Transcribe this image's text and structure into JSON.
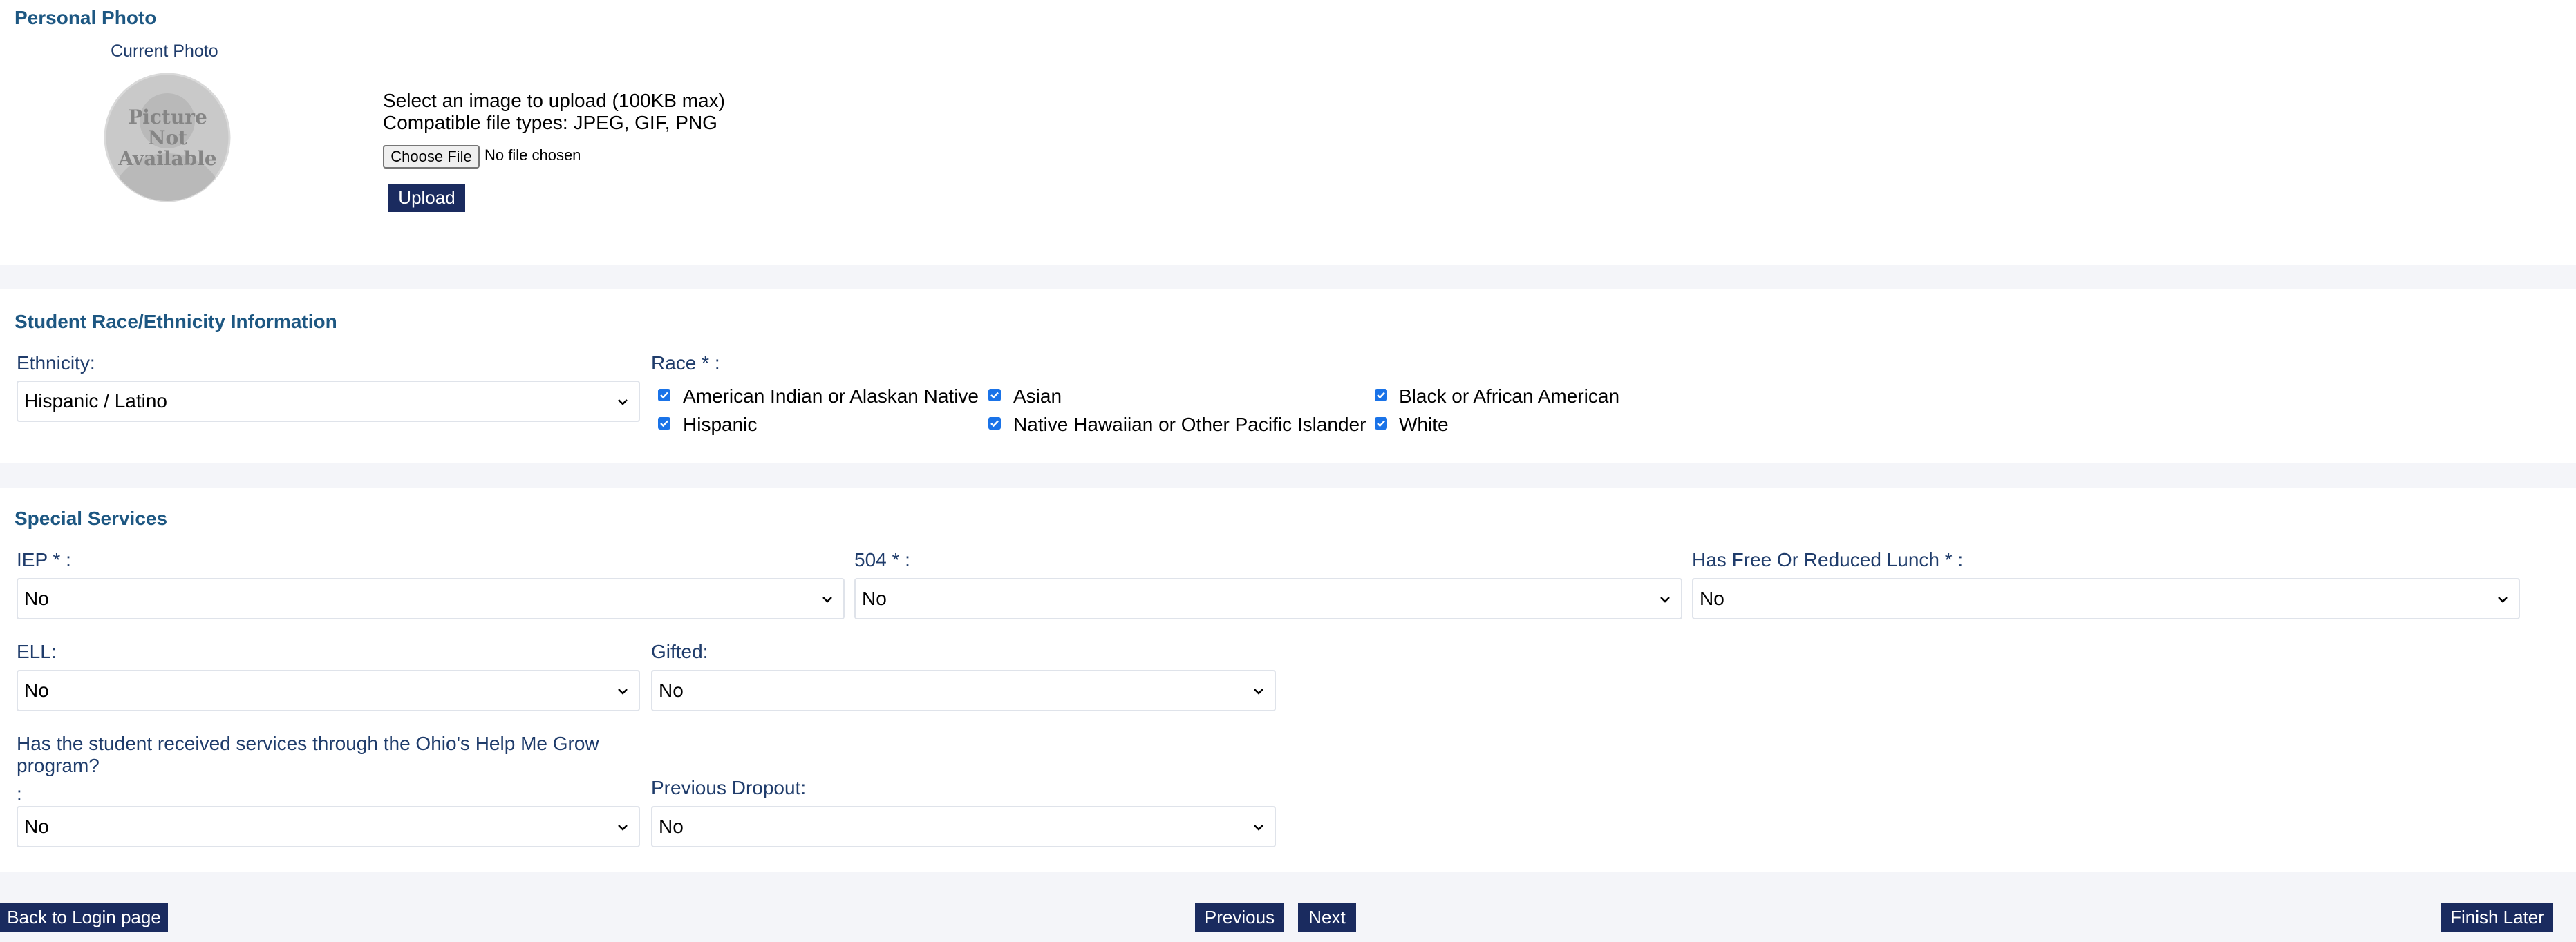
{
  "photo": {
    "section_title": "Personal Photo",
    "current_photo_label": "Current Photo",
    "placeholder_lines": [
      "Picture",
      "Not",
      "Available"
    ],
    "upload_instructions": "Select an image to upload (100KB max)",
    "file_types": "Compatible file types: JPEG, GIF, PNG",
    "choose_file_label": "Choose File",
    "no_file_text": "No file chosen",
    "upload_label": "Upload"
  },
  "race": {
    "section_title": "Student Race/Ethnicity Information",
    "ethnicity_label": "Ethnicity:",
    "ethnicity_value": "Hispanic / Latino",
    "race_label": "Race * :",
    "options": [
      {
        "label": "American Indian or Alaskan Native",
        "checked": true
      },
      {
        "label": "Asian",
        "checked": true
      },
      {
        "label": "Black or African American",
        "checked": true
      },
      {
        "label": "Hispanic",
        "checked": true
      },
      {
        "label": "Native Hawaiian or Other Pacific Islander",
        "checked": true
      },
      {
        "label": "White",
        "checked": true
      }
    ]
  },
  "services": {
    "section_title": "Special Services",
    "iep": {
      "label": "IEP * :",
      "value": "No"
    },
    "s504": {
      "label": "504 * :",
      "value": "No"
    },
    "lunch": {
      "label": "Has Free Or Reduced Lunch * :",
      "value": "No"
    },
    "ell": {
      "label": "ELL:",
      "value": "No"
    },
    "gifted": {
      "label": "Gifted:",
      "value": "No"
    },
    "help_me_grow": {
      "label": "Has the student received services through the Ohio's Help Me Grow program?",
      "colon": ":",
      "value": "No"
    },
    "dropout": {
      "label": "Previous Dropout:",
      "value": "No"
    }
  },
  "footer": {
    "back_label": "Back to Login page",
    "previous_label": "Previous",
    "next_label": "Next",
    "finish_label": "Finish Later"
  },
  "colors": {
    "navy": "#1a2b5f",
    "section_title": "#1d5782",
    "label": "#1f3c6b",
    "checkbox": "#1a73e8",
    "page_bg": "#f4f5f9"
  }
}
